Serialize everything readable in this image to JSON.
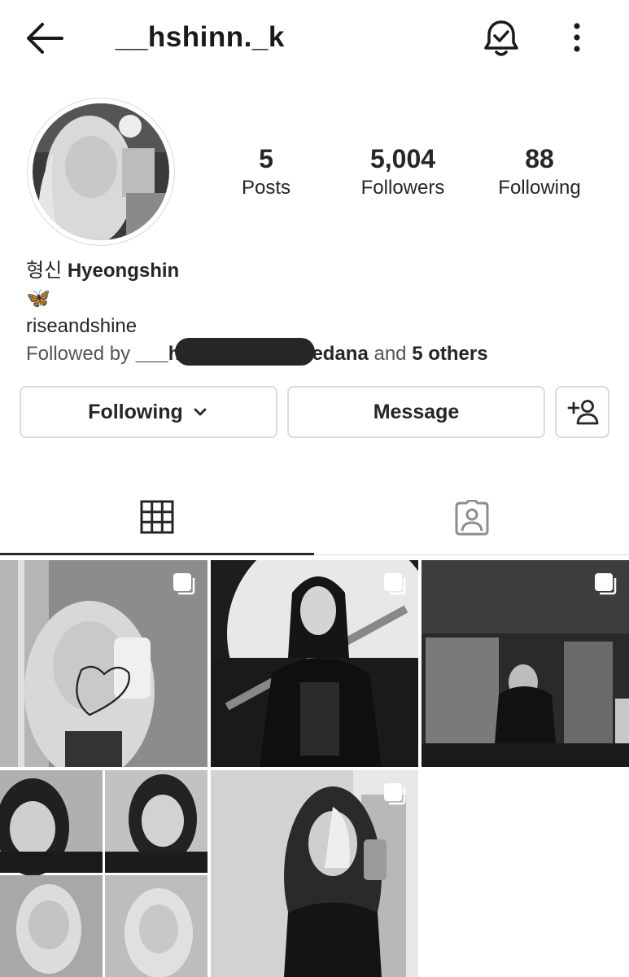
{
  "header": {
    "username": "__hshinn._k"
  },
  "stats": [
    {
      "value": "5",
      "label": "Posts"
    },
    {
      "value": "5,004",
      "label": "Followers"
    },
    {
      "value": "88",
      "label": "Following"
    }
  ],
  "bio": {
    "name_korean": "형신",
    "name_english": "Hyeongshin",
    "emoji": "🦋",
    "text": "riseandshine",
    "followed_prefix": "Followed by",
    "followed_user_start": "___h",
    "followed_user_end": "edana",
    "followed_and": "and",
    "followed_others": "5 others"
  },
  "actions": {
    "following_label": "Following",
    "message_label": "Message"
  },
  "tabs": [
    {
      "name": "posts-grid",
      "icon": "grid-icon",
      "active": true
    },
    {
      "name": "tagged",
      "icon": "tagged-person-icon",
      "active": false
    }
  ],
  "icons": {
    "back": "arrow-left-icon",
    "notifications": "bell-check-icon",
    "more": "more-vertical-icon",
    "dropdown": "chevron-down-icon",
    "suggest": "add-person-icon",
    "multi_post": "carousel-icon"
  },
  "colors": {
    "text": "#262626",
    "border": "#dbdbdb",
    "background": "#ffffff",
    "secondary": "#555555"
  }
}
